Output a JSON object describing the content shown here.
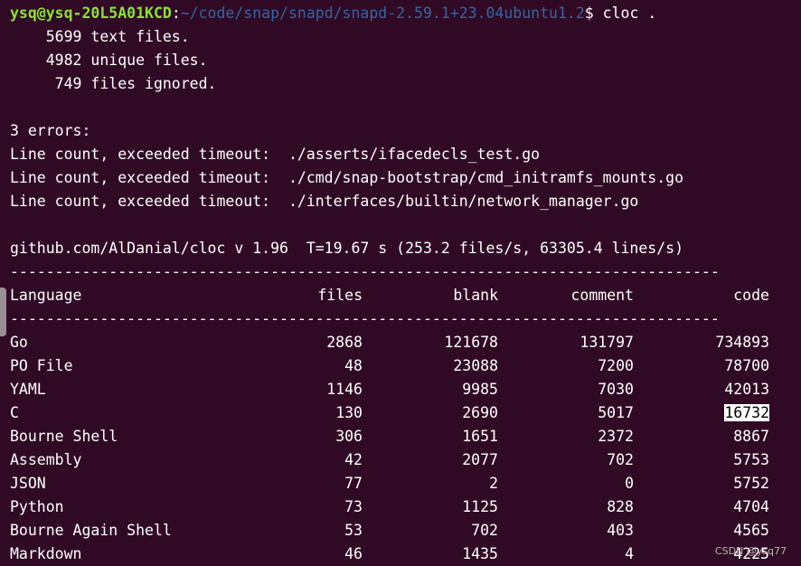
{
  "prompt": {
    "user_host": "ysq@ysq-20L5A01KCD",
    "path": "~/code/snap/snapd/snapd-2.59.1+23.04ubuntu1.2",
    "symbol": "$",
    "command": " cloc ."
  },
  "summary": [
    "    5699 text files.",
    "    4982 unique files.",
    "     749 files ignored."
  ],
  "errors": {
    "header": "3 errors:",
    "lines": [
      "Line count, exceeded timeout:  ./asserts/ifacedecls_test.go",
      "Line count, exceeded timeout:  ./cmd/snap-bootstrap/cmd_initramfs_mounts.go",
      "Line count, exceeded timeout:  ./interfaces/builtin/network_manager.go"
    ]
  },
  "version_line": "github.com/AlDanial/cloc v 1.96  T=19.67 s (253.2 files/s, 63305.4 lines/s)",
  "separator": "-------------------------------------------------------------------------------",
  "table": {
    "headers": [
      "Language",
      "files",
      "blank",
      "comment",
      "code"
    ],
    "rows": [
      [
        "Go",
        "2868",
        "121678",
        "131797",
        "734893"
      ],
      [
        "PO File",
        "48",
        "23088",
        "7200",
        "78700"
      ],
      [
        "YAML",
        "1146",
        "9985",
        "7030",
        "42013"
      ],
      [
        "C",
        "130",
        "2690",
        "5017",
        "16732"
      ],
      [
        "Bourne Shell",
        "306",
        "1651",
        "2372",
        "8867"
      ],
      [
        "Assembly",
        "42",
        "2077",
        "702",
        "5753"
      ],
      [
        "JSON",
        "77",
        "2",
        "0",
        "5752"
      ],
      [
        "Python",
        "73",
        "1125",
        "828",
        "4704"
      ],
      [
        "Bourne Again Shell",
        "53",
        "702",
        "403",
        "4565"
      ],
      [
        "Markdown",
        "46",
        "1435",
        "4",
        "4225"
      ]
    ]
  },
  "watermark": "CSDN @ysq77",
  "colors": {
    "background": "#300a24",
    "prompt_user": "#8ae234",
    "prompt_path": "#3465a4"
  }
}
